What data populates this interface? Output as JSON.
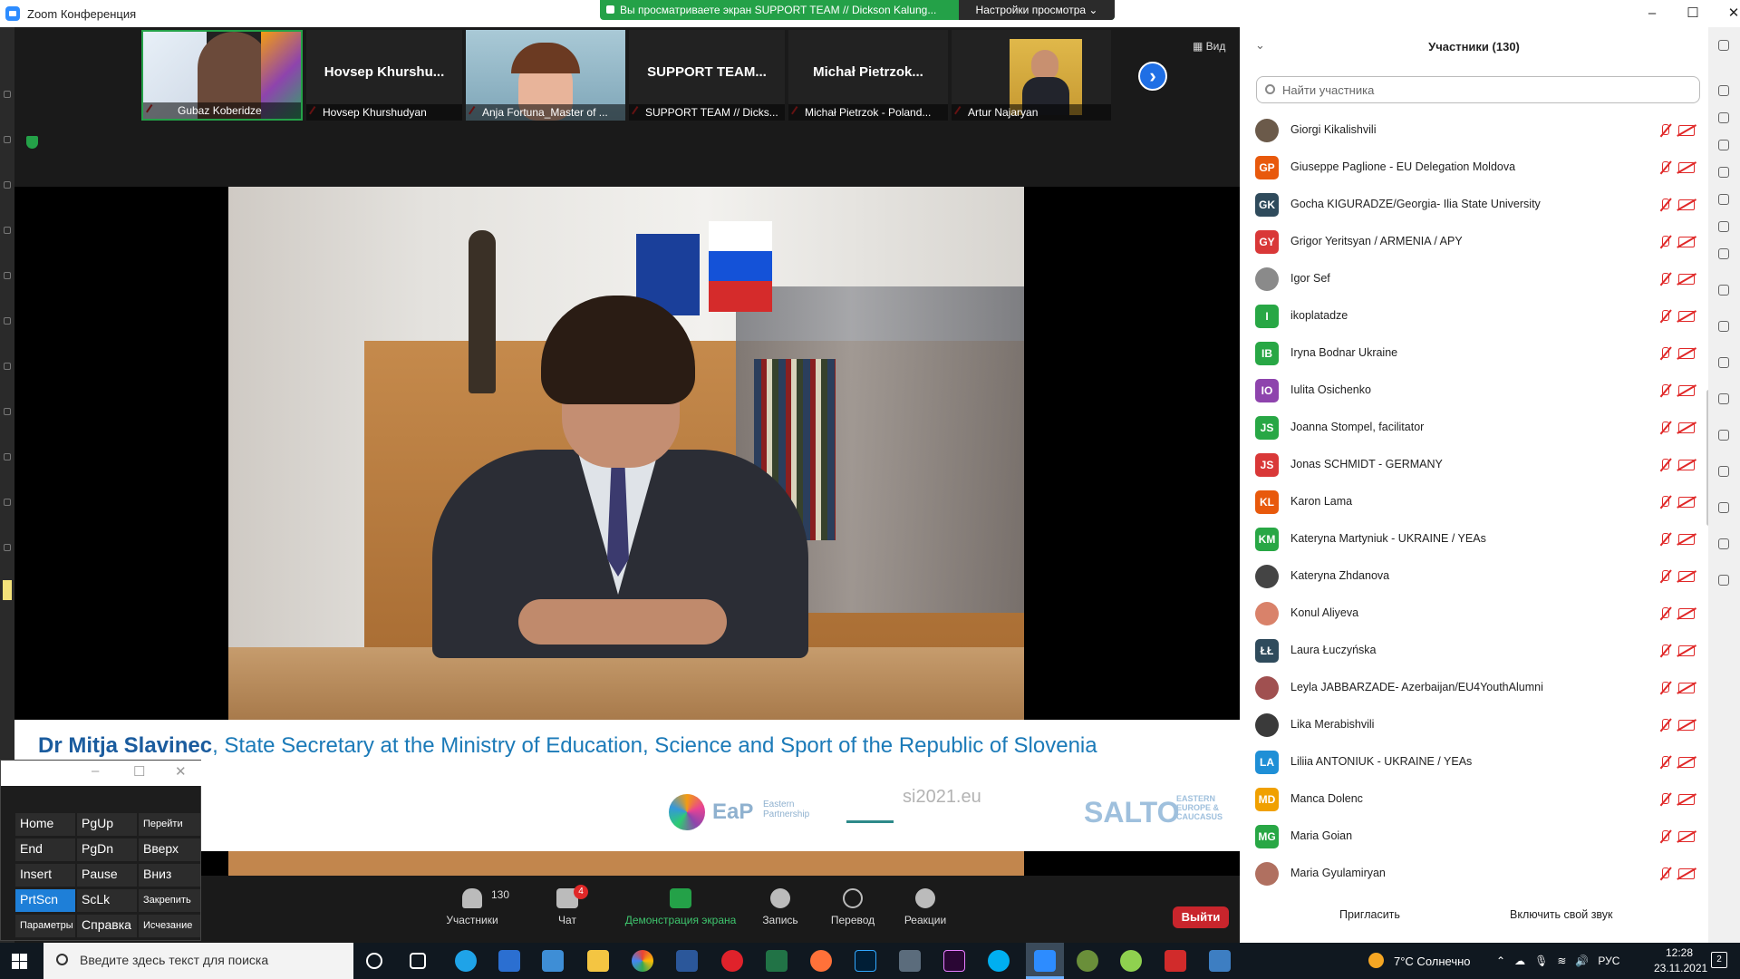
{
  "window": {
    "title": "Zoom Конференция",
    "minimize": "–",
    "maximize": "☐",
    "close": "✕"
  },
  "share_banner": {
    "text": "Вы просматриваете экран SUPPORT TEAM // Dickson Kalung...",
    "view_options": "Настройки просмотра ⌄"
  },
  "thumbnails": [
    {
      "name": "Gubaz Koberidze",
      "big": "",
      "active": true
    },
    {
      "name": "Hovsep Khurshudyan",
      "big": "Hovsep  Khurshu..."
    },
    {
      "name": "Anja Fortuna_Master of ...",
      "big": ""
    },
    {
      "name": "SUPPORT TEAM // Dicks...",
      "big": "SUPPORT  TEAM..."
    },
    {
      "name": "Michał Pietrzok - Poland...",
      "big": "Michał  Pietrzok..."
    },
    {
      "name": "Artur Najaryan",
      "big": ""
    }
  ],
  "view_button": "Вид",
  "shared": {
    "caption_name": "Dr Mitja Slavinec",
    "caption_rest": ", State Secretary at the Ministry of Education, Science and Sport of the Republic of Slovenia",
    "logo_eap": "EaP",
    "logo_eap_sub": "Eastern Partnership",
    "logo_si": "si2021.eu",
    "logo_salto": "SALTO",
    "logo_salto_sub": "EASTERN EUROPE & CAUCASUS"
  },
  "toolbar": {
    "participants_count": "130",
    "participants": "Участники",
    "chat": "Чат",
    "chat_badge": "4",
    "share": "Демонстрация экрана",
    "record": "Запись",
    "translate": "Перевод",
    "reactions": "Реакции",
    "leave": "Выйти"
  },
  "panel": {
    "title": "Участники (130)",
    "search_placeholder": "Найти участника",
    "invite": "Пригласить",
    "unmute_self": "Включить свой звук",
    "participants": [
      {
        "initials": "",
        "name": "Giorgi Kikalishvili",
        "color": "#6b5a4a",
        "photo": true
      },
      {
        "initials": "GP",
        "name": "Giuseppe Paglione - EU Delegation Moldova",
        "color": "#e8590c"
      },
      {
        "initials": "GK",
        "name": "Gocha KIGURADZE/Georgia- Ilia State University",
        "color": "#2f4b5c"
      },
      {
        "initials": "GY",
        "name": "Grigor Yeritsyan / ARMENIA / APY",
        "color": "#d93838"
      },
      {
        "initials": "",
        "name": "Igor Sef",
        "color": "#8a8a8a",
        "photo": true
      },
      {
        "initials": "I",
        "name": "ikoplatadze",
        "color": "#28a745"
      },
      {
        "initials": "IB",
        "name": "Iryna Bodnar Ukraine",
        "color": "#28a745"
      },
      {
        "initials": "IO",
        "name": "Iulita Osichenko",
        "color": "#8e44ad"
      },
      {
        "initials": "JS",
        "name": "Joanna Stompel, facilitator",
        "color": "#28a745"
      },
      {
        "initials": "JS",
        "name": "Jonas SCHMIDT - GERMANY",
        "color": "#d93838"
      },
      {
        "initials": "KL",
        "name": "Karon Lama",
        "color": "#e8590c"
      },
      {
        "initials": "KM",
        "name": "Kateryna Martyniuk - UKRAINE / YEAs",
        "color": "#28a745"
      },
      {
        "initials": "",
        "name": "Kateryna Zhdanova",
        "color": "#444",
        "photo": true
      },
      {
        "initials": "",
        "name": "Konul Aliyeva",
        "color": "#d9826a",
        "photo": true
      },
      {
        "initials": "ŁŁ",
        "name": "Laura Łuczyńska",
        "color": "#2f4b5c"
      },
      {
        "initials": "",
        "name": "Leyla JABBARZADE- Azerbaijan/EU4YouthAlumni",
        "color": "#a05050",
        "photo": true
      },
      {
        "initials": "",
        "name": "Lika Merabishvili",
        "color": "#3a3a3a",
        "photo": true
      },
      {
        "initials": "LA",
        "name": "Liliia ANTONIUK - UKRAINE / YEAs",
        "color": "#1f8fd6"
      },
      {
        "initials": "MD",
        "name": "Manca Dolenc",
        "color": "#f0a000"
      },
      {
        "initials": "MG",
        "name": "Maria Goian",
        "color": "#28a745"
      },
      {
        "initials": "",
        "name": "Maria Gyulamiryan",
        "color": "#b07060",
        "photo": true
      }
    ]
  },
  "osk": {
    "keys": [
      [
        "Home",
        "PgUp",
        "Перейти"
      ],
      [
        "End",
        "PgDn",
        "Вверх"
      ],
      [
        "Insert",
        "Pause",
        "Вниз"
      ],
      [
        "PrtScn",
        "ScLk",
        "Закрепить"
      ],
      [
        "Параметры",
        "Справка",
        "Исчезание"
      ]
    ]
  },
  "taskbar": {
    "search_placeholder": "Введите здесь текст для поиска",
    "weather": "7°C  Солнечно",
    "lang": "РУС",
    "time": "12:28",
    "date": "23.11.2021",
    "notifications": "2"
  }
}
